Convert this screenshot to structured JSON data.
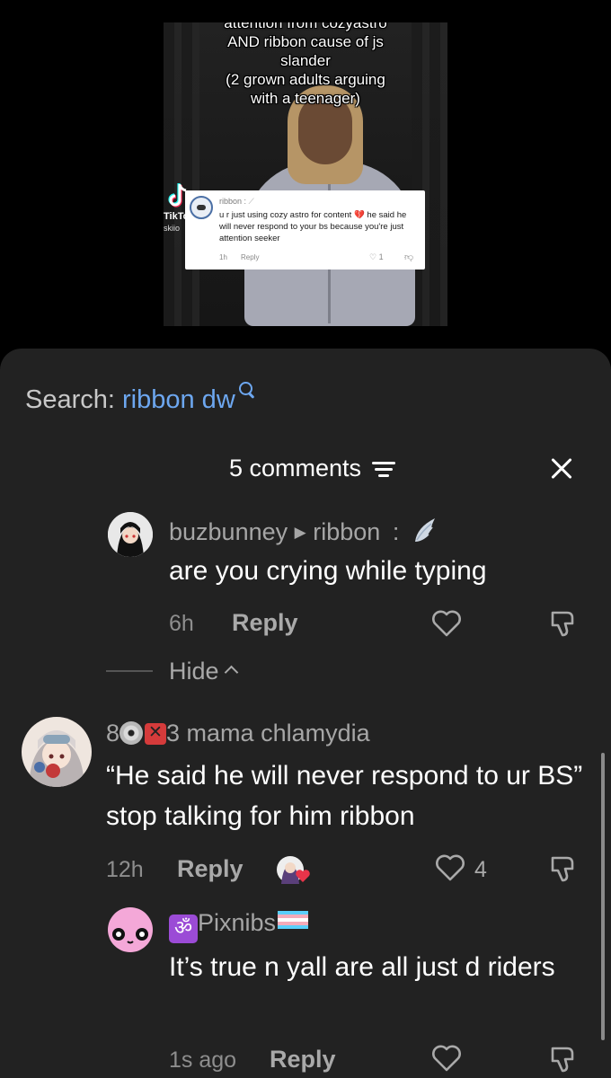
{
  "video": {
    "caption_lines": [
      "attention from cozyastro",
      "AND ribbon cause of js",
      "slander",
      "(2 grown adults arguing",
      "with a teenager)"
    ],
    "watermark": "TikTo",
    "watermark_sub": "skiio",
    "reply_card": {
      "user": "ribbon :",
      "text": "u r just using cozy astro for content 💔 he said he will never respond to your bs because you're just attention seeker",
      "time": "1h",
      "reply_label": "Reply",
      "likes": "1"
    }
  },
  "sheet": {
    "search_prefix": "Search:",
    "search_query": "ribbon dw",
    "comments_count": "5 comments",
    "hide_label": "Hide",
    "comments": [
      {
        "user": "buzbunney",
        "reply_to": "ribbon",
        "separator": ":",
        "text": "are you crying while typing",
        "time": "6h",
        "reply_label": "Reply"
      },
      {
        "user_prefix": "8",
        "user_suffix": "3 mama chlamydia",
        "text": "“He said he will never respond to ur BS” stop talking for him ribbon",
        "time": "12h",
        "reply_label": "Reply",
        "likes": "4"
      },
      {
        "badge": "ॐ",
        "user": "Pixnibs",
        "text": "It’s true n yall are all just d riders",
        "time": "1s ago",
        "reply_label": "Reply"
      }
    ]
  },
  "colors": {
    "sheet_bg": "#222222",
    "search_accent": "#6da7f0",
    "muted_text": "#a9a9a9"
  }
}
